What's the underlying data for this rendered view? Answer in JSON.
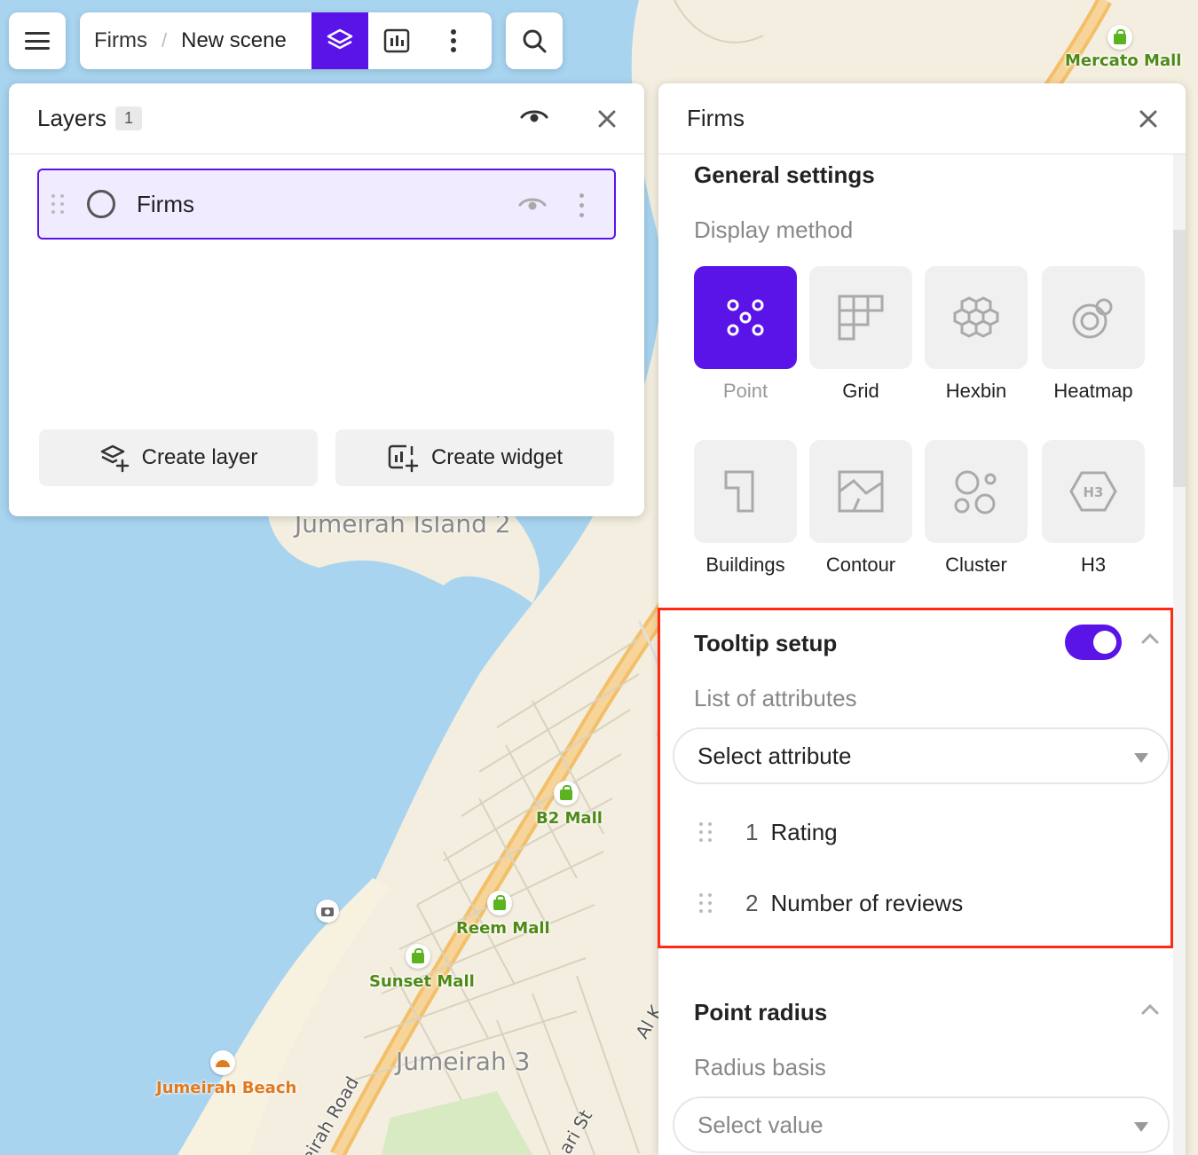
{
  "toolbar": {
    "breadcrumb_root": "Firms",
    "breadcrumb_sep": "/",
    "breadcrumb_current": "New scene"
  },
  "layers_panel": {
    "title": "Layers",
    "count": "1",
    "layers": [
      {
        "name": "Firms"
      }
    ],
    "create_layer": "Create layer",
    "create_widget": "Create widget"
  },
  "firms_panel": {
    "title": "Firms",
    "general_settings": "General settings",
    "display_method": "Display method",
    "methods": [
      {
        "label": "Point",
        "icon": "points-icon",
        "selected": true
      },
      {
        "label": "Grid",
        "icon": "grid-icon",
        "selected": false
      },
      {
        "label": "Hexbin",
        "icon": "hexbin-icon",
        "selected": false
      },
      {
        "label": "Heatmap",
        "icon": "heatmap-icon",
        "selected": false
      },
      {
        "label": "Buildings",
        "icon": "buildings-icon",
        "selected": false
      },
      {
        "label": "Contour",
        "icon": "contour-icon",
        "selected": false
      },
      {
        "label": "Cluster",
        "icon": "cluster-icon",
        "selected": false
      },
      {
        "label": "H3",
        "icon": "h3-icon",
        "selected": false
      }
    ],
    "tooltip": {
      "title": "Tooltip setup",
      "enabled": true,
      "list_label": "List of attributes",
      "select_placeholder": "Select attribute",
      "attributes": [
        {
          "num": "1",
          "name": "Rating"
        },
        {
          "num": "2",
          "name": "Number of reviews"
        }
      ]
    },
    "point_radius": {
      "title": "Point radius",
      "basis_label": "Radius basis",
      "select_placeholder": "Select value"
    }
  },
  "map": {
    "labels": {
      "mercato": "Mercato Mall",
      "b2": "B2 Mall",
      "reem": "Reem Mall",
      "sunset": "Sunset Mall",
      "jumeirah_beach": "Jumeirah Beach",
      "jumeirah_island": "Jumeirah Island 2",
      "jumeirah3": "Jumeirah 3",
      "road": "eirah Road",
      "st": "ari St",
      "al_k": "Al K"
    }
  },
  "colors": {
    "accent": "#5a14e8",
    "highlight": "#ff2a12",
    "water": "#a8d4f0",
    "land": "#f3eedf",
    "poi_green": "#4f8a16"
  }
}
